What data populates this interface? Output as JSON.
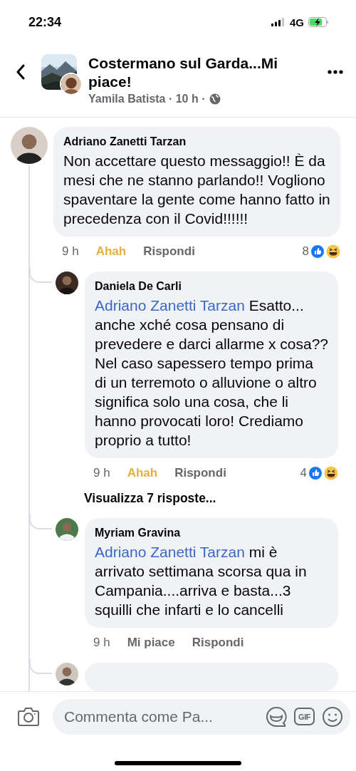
{
  "status_bar": {
    "time": "22:34",
    "network": "4G"
  },
  "header": {
    "title": "Costermano sul Garda...Mi piace!",
    "subtitle": "Yamila Batista · 10 h ·"
  },
  "comment": {
    "author": "Adriano Zanetti Tarzan",
    "text": "Non accettare questo messaggio!! È da mesi che ne stanno parlando!! Vogliono spaventare la gente come hanno fatto in precedenza con il Covid!!!!!!",
    "time": "9 h",
    "reaction_label": "Ahah",
    "reacted": true,
    "reply_label": "Rispondi",
    "reaction_count": "8",
    "reactions": [
      {
        "kind": "like"
      },
      {
        "kind": "haha"
      }
    ]
  },
  "replies": [
    {
      "kind": "comment",
      "author": "Daniela De Carli",
      "mention": "Adriano Zanetti Tarzan",
      "text": "Esatto... anche xché cosa pensano di prevedere e darci allarme x cosa?? Nel caso sapessero tempo prima di un terremoto o alluvione o altro significa solo una cosa, che li hanno provocati loro! Crediamo proprio a tutto!",
      "time": "9 h",
      "reaction_label": "Ahah",
      "reacted": true,
      "reply_label": "Rispondi",
      "reaction_count": "4",
      "reactions": [
        {
          "kind": "like"
        },
        {
          "kind": "haha"
        }
      ]
    },
    {
      "kind": "more",
      "label": "Visualizza 7 risposte..."
    },
    {
      "kind": "comment",
      "author": "Myriam Gravina",
      "mention": "Adriano Zanetti Tarzan",
      "text": "mi è arrivato settimana scorsa qua in Campania....arriva e basta...3 squilli che infarti e lo cancelli",
      "time": "9 h",
      "reaction_label": "Mi piace",
      "reacted": false,
      "reply_label": "Rispondi"
    },
    {
      "kind": "cut"
    }
  ],
  "composer": {
    "placeholder": "Commenta come Pa...",
    "gif_label": "GIF"
  }
}
